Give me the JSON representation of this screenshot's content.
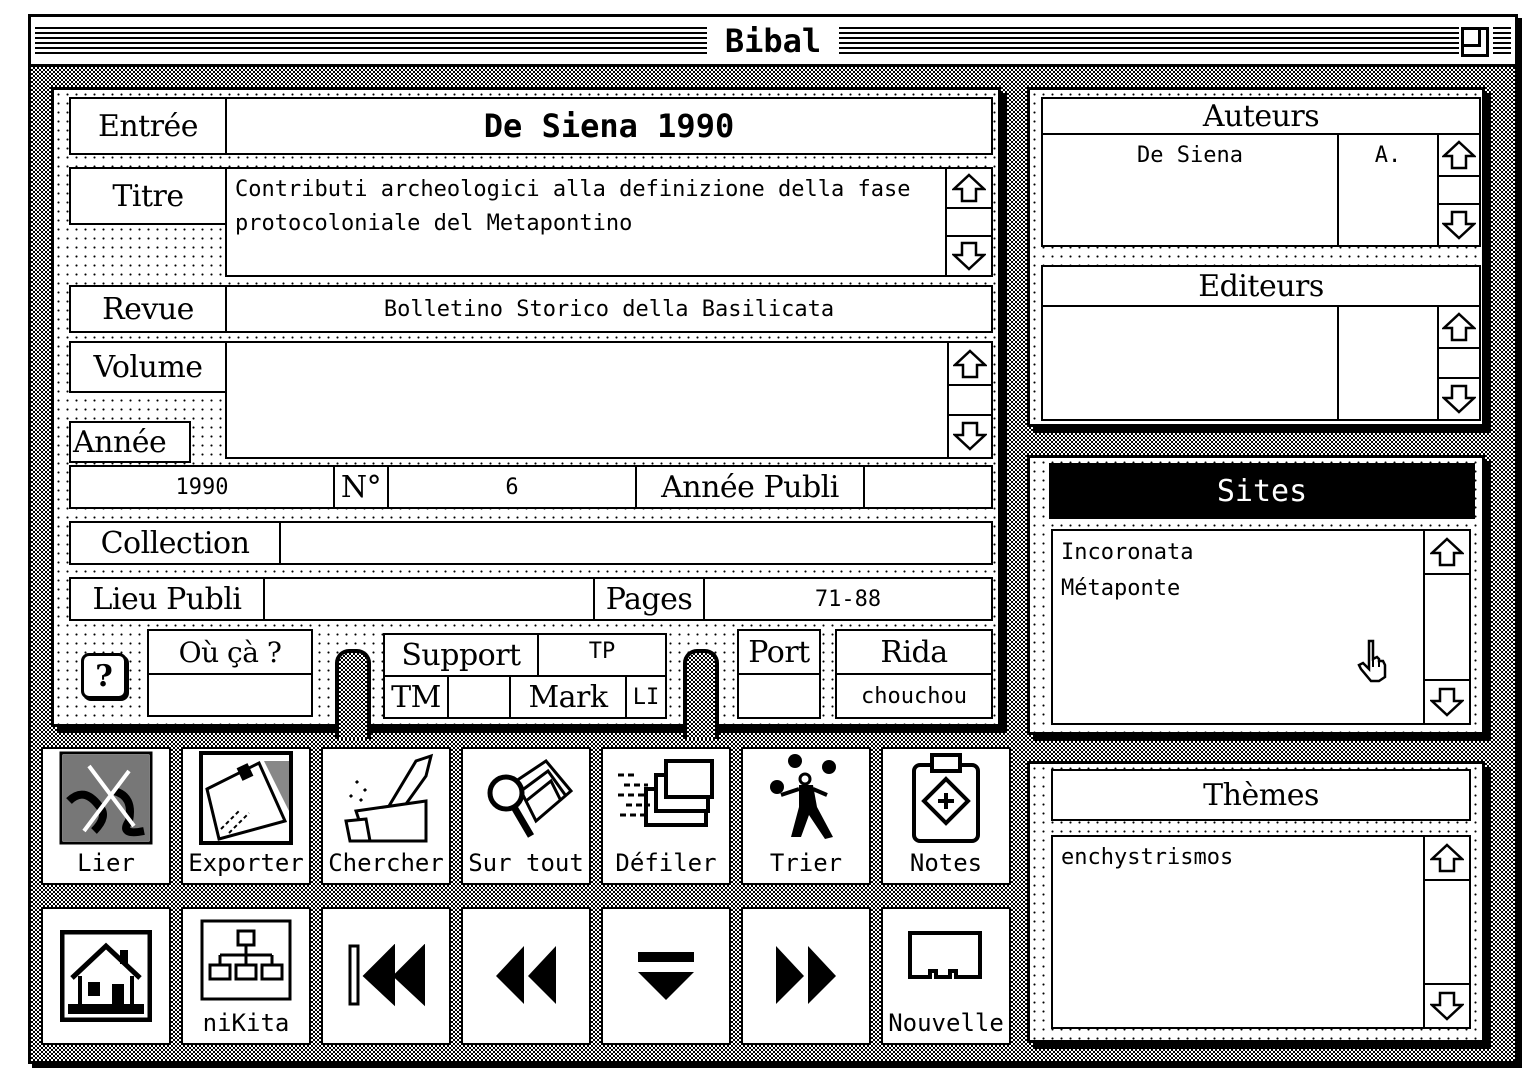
{
  "window": {
    "title": "Bibal",
    "zoom_box_icon": "zoom-box-icon"
  },
  "record": {
    "entree_label": "Entrée",
    "entree_value": "De Siena 1990",
    "titre_label": "Titre",
    "titre_value": "Contributi archeologici alla definizione della fase protocoloniale del Metapontino",
    "titre_lines": [
      "Contributi archeologici alla definizione della fase",
      "protocoloniale del Metapontino"
    ],
    "revue_label": "Revue",
    "revue_value": "Bolletino Storico della Basilicata",
    "volume_label": "Volume",
    "volume_value": "",
    "annee_label": "Année",
    "annee_value": "1990",
    "numero_label": "N°",
    "numero_value": "6",
    "annee_publi_label": "Année Publi",
    "annee_publi_value": "",
    "collection_label": "Collection",
    "collection_value": "",
    "lieu_publi_label": "Lieu Publi",
    "lieu_publi_value": "",
    "pages_label": "Pages",
    "pages_value": "71-88",
    "help_label": "?",
    "ou_ca_label": "Où çà ?",
    "ou_ca_value": "",
    "support_label": "Support",
    "support_value": "TP",
    "tm_label": "TM",
    "tm_value": "",
    "mark_label": "Mark",
    "mark_value": "LI",
    "port_label": "Port",
    "port_value": "",
    "rida_label": "Rida",
    "rida_value": "chouchou"
  },
  "auteurs": {
    "title": "Auteurs",
    "rows": [
      {
        "name": "De Siena",
        "initial": "A."
      }
    ]
  },
  "editeurs": {
    "title": "Editeurs",
    "rows": []
  },
  "sites": {
    "title": "Sites",
    "items": [
      "Incoronata",
      "Métaponte"
    ]
  },
  "themes": {
    "title": "Thèmes",
    "items": [
      "enchystrismos"
    ]
  },
  "toolbar_top": [
    {
      "label": "Lier",
      "icon": "puzzle-link-icon"
    },
    {
      "label": "Exporter",
      "icon": "envelope-export-icon"
    },
    {
      "label": "Chercher",
      "icon": "hand-search-icon"
    },
    {
      "label": "Sur tout",
      "icon": "magnifier-cards-icon"
    },
    {
      "label": "Défiler",
      "icon": "scroll-cards-icon"
    },
    {
      "label": "Trier",
      "icon": "juggler-sort-icon"
    },
    {
      "label": "Notes",
      "icon": "clipboard-notes-icon"
    }
  ],
  "toolbar_bottom": [
    {
      "label": "",
      "icon": "home-icon"
    },
    {
      "label": "niKita",
      "icon": "hierarchy-icon"
    },
    {
      "label": "",
      "icon": "first-record-icon"
    },
    {
      "label": "",
      "icon": "previous-record-icon"
    },
    {
      "label": "",
      "icon": "dropdown-list-icon"
    },
    {
      "label": "",
      "icon": "next-record-icon"
    },
    {
      "label": "Nouvelle",
      "icon": "new-card-icon"
    }
  ]
}
